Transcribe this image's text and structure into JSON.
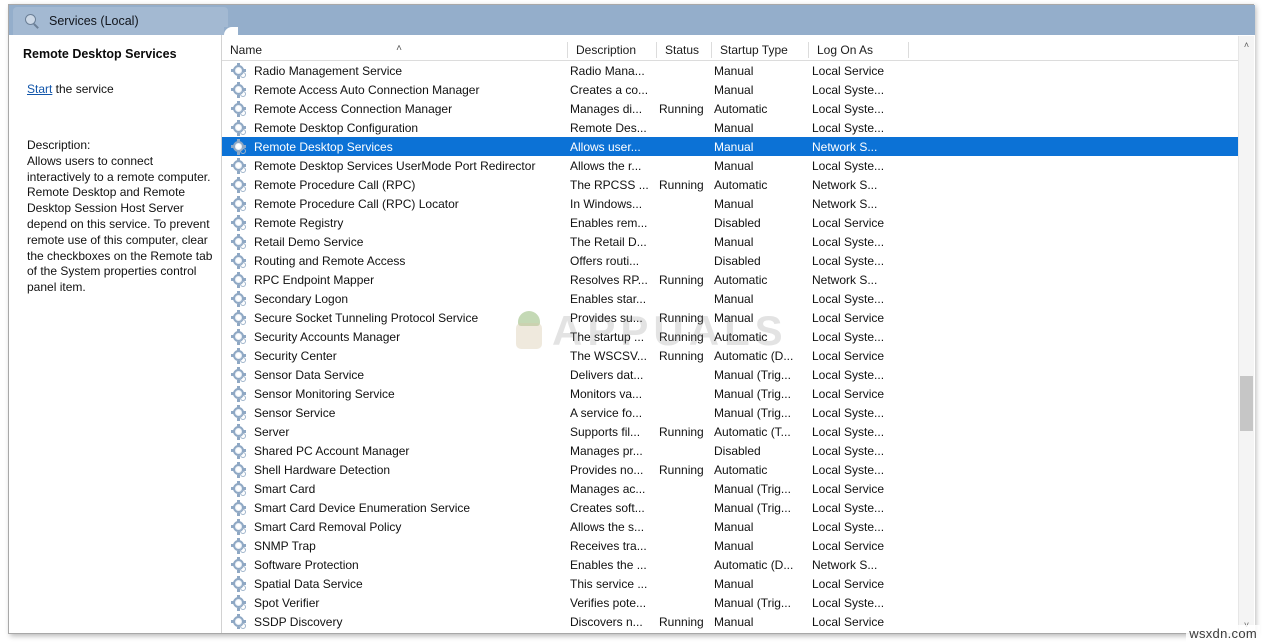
{
  "window": {
    "tab_label": "Services (Local)",
    "tab_icon": "magnifier-icon"
  },
  "details_pane": {
    "title": "Remote Desktop Services",
    "start_link": "Start",
    "start_suffix": " the service",
    "description_label": "Description:",
    "description_text": "Allows users to connect interactively to a remote computer. Remote Desktop and Remote Desktop Session Host Server depend on this service. To prevent remote use of this computer, clear the checkboxes on the Remote tab of the System properties control panel item."
  },
  "list": {
    "columns": [
      "Name",
      "Description",
      "Status",
      "Startup Type",
      "Log On As"
    ],
    "sort_column": "Name",
    "sort_direction": "ascending",
    "sort_icon": "chevron-up-icon",
    "selected_row_index": 4,
    "selection_color": "#0c72d6",
    "row_icon": "service-gear-icon",
    "rows": [
      {
        "name": "Radio Management Service",
        "description": "Radio Mana...",
        "status": "",
        "startup": "Manual",
        "logon": "Local Service"
      },
      {
        "name": "Remote Access Auto Connection Manager",
        "description": "Creates a co...",
        "status": "",
        "startup": "Manual",
        "logon": "Local Syste..."
      },
      {
        "name": "Remote Access Connection Manager",
        "description": "Manages di...",
        "status": "Running",
        "startup": "Automatic",
        "logon": "Local Syste..."
      },
      {
        "name": "Remote Desktop Configuration",
        "description": "Remote Des...",
        "status": "",
        "startup": "Manual",
        "logon": "Local Syste..."
      },
      {
        "name": "Remote Desktop Services",
        "description": "Allows user...",
        "status": "",
        "startup": "Manual",
        "logon": "Network S..."
      },
      {
        "name": "Remote Desktop Services UserMode Port Redirector",
        "description": "Allows the r...",
        "status": "",
        "startup": "Manual",
        "logon": "Local Syste..."
      },
      {
        "name": "Remote Procedure Call (RPC)",
        "description": "The RPCSS ...",
        "status": "Running",
        "startup": "Automatic",
        "logon": "Network S..."
      },
      {
        "name": "Remote Procedure Call (RPC) Locator",
        "description": "In Windows...",
        "status": "",
        "startup": "Manual",
        "logon": "Network S..."
      },
      {
        "name": "Remote Registry",
        "description": "Enables rem...",
        "status": "",
        "startup": "Disabled",
        "logon": "Local Service"
      },
      {
        "name": "Retail Demo Service",
        "description": "The Retail D...",
        "status": "",
        "startup": "Manual",
        "logon": "Local Syste..."
      },
      {
        "name": "Routing and Remote Access",
        "description": "Offers routi...",
        "status": "",
        "startup": "Disabled",
        "logon": "Local Syste..."
      },
      {
        "name": "RPC Endpoint Mapper",
        "description": "Resolves RP...",
        "status": "Running",
        "startup": "Automatic",
        "logon": "Network S..."
      },
      {
        "name": "Secondary Logon",
        "description": "Enables star...",
        "status": "",
        "startup": "Manual",
        "logon": "Local Syste..."
      },
      {
        "name": "Secure Socket Tunneling Protocol Service",
        "description": "Provides su...",
        "status": "Running",
        "startup": "Manual",
        "logon": "Local Service"
      },
      {
        "name": "Security Accounts Manager",
        "description": "The startup ...",
        "status": "Running",
        "startup": "Automatic",
        "logon": "Local Syste..."
      },
      {
        "name": "Security Center",
        "description": "The WSCSV...",
        "status": "Running",
        "startup": "Automatic (D...",
        "logon": "Local Service"
      },
      {
        "name": "Sensor Data Service",
        "description": "Delivers dat...",
        "status": "",
        "startup": "Manual (Trig...",
        "logon": "Local Syste..."
      },
      {
        "name": "Sensor Monitoring Service",
        "description": "Monitors va...",
        "status": "",
        "startup": "Manual (Trig...",
        "logon": "Local Service"
      },
      {
        "name": "Sensor Service",
        "description": "A service fo...",
        "status": "",
        "startup": "Manual (Trig...",
        "logon": "Local Syste..."
      },
      {
        "name": "Server",
        "description": "Supports fil...",
        "status": "Running",
        "startup": "Automatic (T...",
        "logon": "Local Syste..."
      },
      {
        "name": "Shared PC Account Manager",
        "description": "Manages pr...",
        "status": "",
        "startup": "Disabled",
        "logon": "Local Syste..."
      },
      {
        "name": "Shell Hardware Detection",
        "description": "Provides no...",
        "status": "Running",
        "startup": "Automatic",
        "logon": "Local Syste..."
      },
      {
        "name": "Smart Card",
        "description": "Manages ac...",
        "status": "",
        "startup": "Manual (Trig...",
        "logon": "Local Service"
      },
      {
        "name": "Smart Card Device Enumeration Service",
        "description": "Creates soft...",
        "status": "",
        "startup": "Manual (Trig...",
        "logon": "Local Syste..."
      },
      {
        "name": "Smart Card Removal Policy",
        "description": "Allows the s...",
        "status": "",
        "startup": "Manual",
        "logon": "Local Syste..."
      },
      {
        "name": "SNMP Trap",
        "description": "Receives tra...",
        "status": "",
        "startup": "Manual",
        "logon": "Local Service"
      },
      {
        "name": "Software Protection",
        "description": "Enables the ...",
        "status": "",
        "startup": "Automatic (D...",
        "logon": "Network S..."
      },
      {
        "name": "Spatial Data Service",
        "description": "This service ...",
        "status": "",
        "startup": "Manual",
        "logon": "Local Service"
      },
      {
        "name": "Spot Verifier",
        "description": "Verifies pote...",
        "status": "",
        "startup": "Manual (Trig...",
        "logon": "Local Syste..."
      },
      {
        "name": "SSDP Discovery",
        "description": "Discovers n...",
        "status": "Running",
        "startup": "Manual",
        "logon": "Local Service"
      }
    ]
  },
  "scrollbar": {
    "up_arrow": "˄",
    "down_arrow": "˅"
  },
  "watermarks": {
    "appuals": "APPUALS",
    "wsxdn": "wsxdn.com"
  }
}
